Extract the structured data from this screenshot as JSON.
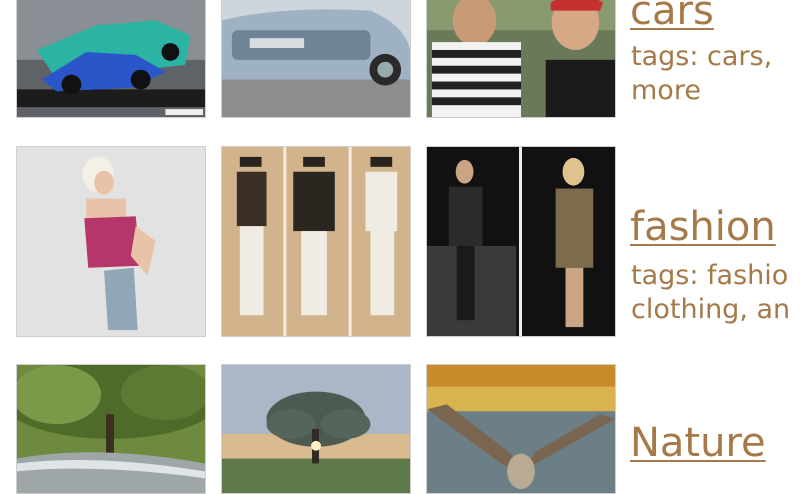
{
  "categories": [
    {
      "title": "cars",
      "tags_line1": "tags: cars,",
      "tags_line2": "more",
      "thumbs": [
        {
          "name": "drift race car photo"
        },
        {
          "name": "silver hatchback photo"
        },
        {
          "name": "two men smiling photo"
        }
      ]
    },
    {
      "title": "fashion",
      "tags_line1": "tags: fashio",
      "tags_line2": "clothing, an",
      "thumbs": [
        {
          "name": "woman in pink corset photo"
        },
        {
          "name": "man in suit triptych photo"
        },
        {
          "name": "runway models photo"
        }
      ]
    },
    {
      "title": "Nature",
      "thumbs": [
        {
          "name": "oak tree with stream photo"
        },
        {
          "name": "lone tree at sunset photo"
        },
        {
          "name": "bird in flight photo"
        }
      ]
    }
  ]
}
